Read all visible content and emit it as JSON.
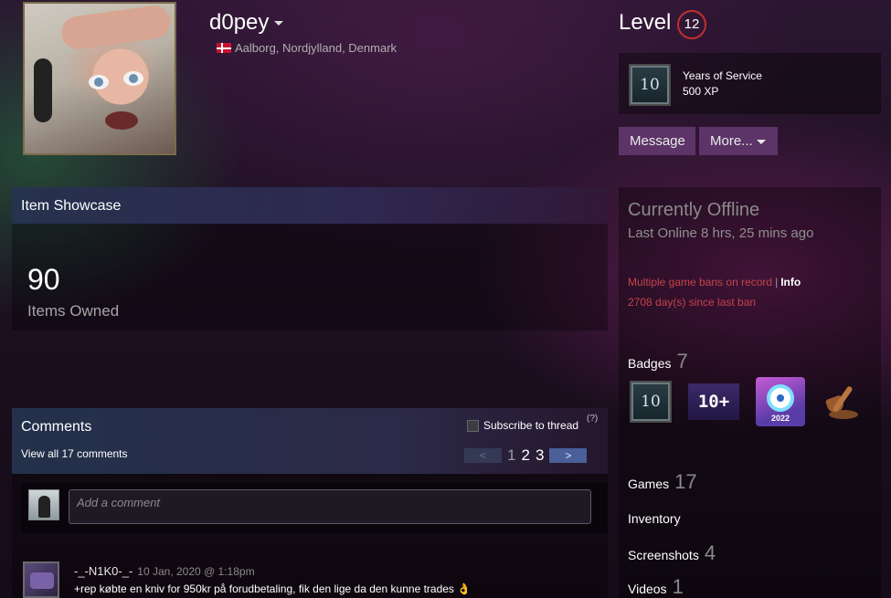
{
  "profile": {
    "username": "d0pey",
    "location": "Aalborg, Nordjylland, Denmark",
    "country_flag": "denmark-flag"
  },
  "level": {
    "label": "Level",
    "value": "12"
  },
  "featured_badge": {
    "icon_text": "10",
    "title": "Years of Service",
    "xp": "500 XP"
  },
  "actions": {
    "message_label": "Message",
    "more_label": "More..."
  },
  "showcase": {
    "title": "Item Showcase",
    "count": "90",
    "count_label": "Items Owned"
  },
  "comments": {
    "title": "Comments",
    "view_all": "View all 17 comments",
    "subscribe_label": "Subscribe to thread",
    "help": "(?)",
    "pager": {
      "prev": "<",
      "next": ">",
      "pages": [
        "1",
        "2",
        "3"
      ]
    },
    "input_placeholder": "Add a comment",
    "items": [
      {
        "author": "-_-N1K0-_-",
        "date": "10 Jan, 2020 @ 1:18pm",
        "text": "+rep købte en kniv for 950kr på forudbetaling, fik den lige da den kunne trades 👌"
      }
    ]
  },
  "status": {
    "state": "Currently Offline",
    "last_online": "Last Online 8 hrs, 25 mins ago",
    "bans_text": "Multiple game bans on record",
    "bans_separator": "|",
    "bans_info": "Info",
    "ban_days": "2708 day(s) since last ban"
  },
  "stats": {
    "badges_label": "Badges",
    "badges_count": "7",
    "games_label": "Games",
    "games_count": "17",
    "inventory_label": "Inventory",
    "screenshots_label": "Screenshots",
    "screenshots_count": "4",
    "videos_label": "Videos",
    "videos_count": "1"
  },
  "badges": [
    {
      "icon": "years-of-service-10-badge-icon",
      "text": "10"
    },
    {
      "icon": "ten-plus-badge-icon",
      "text": "10+"
    },
    {
      "icon": "steam-replay-2022-badge-icon",
      "text": "2022"
    },
    {
      "icon": "shovel-badge-icon",
      "text": ""
    }
  ],
  "colors": {
    "accent_button": "#5c3467",
    "ban_red": "#c4434a",
    "level_ring": "#c0302e",
    "pager_next": "#4b5f99"
  }
}
